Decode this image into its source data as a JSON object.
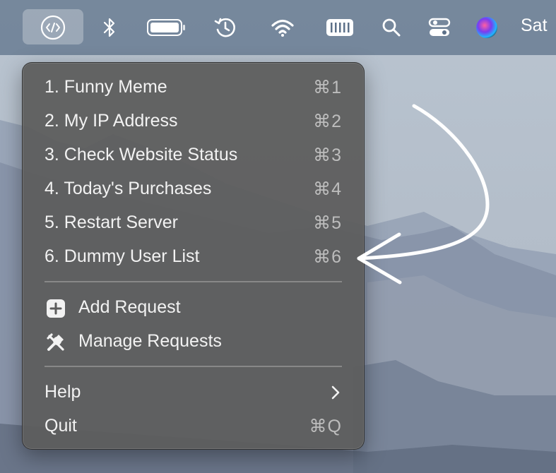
{
  "menubar": {
    "icons": [
      "code-icon",
      "bluetooth-icon",
      "battery-icon",
      "time-machine-icon",
      "wifi-icon",
      "keyboard-icon",
      "search-icon",
      "control-center-icon",
      "siri-icon"
    ],
    "clock": "Sat"
  },
  "menu": {
    "requests": [
      {
        "label": "1. Funny Meme",
        "shortcut": "⌘1"
      },
      {
        "label": "2. My IP Address",
        "shortcut": "⌘2"
      },
      {
        "label": "3. Check Website Status",
        "shortcut": "⌘3"
      },
      {
        "label": "4. Today's Purchases",
        "shortcut": "⌘4"
      },
      {
        "label": "5. Restart Server",
        "shortcut": "⌘5"
      },
      {
        "label": "6. Dummy User List",
        "shortcut": "⌘6"
      }
    ],
    "add_request": "Add Request",
    "manage_requests": "Manage Requests",
    "help": "Help",
    "quit": "Quit",
    "quit_shortcut": "⌘Q"
  }
}
